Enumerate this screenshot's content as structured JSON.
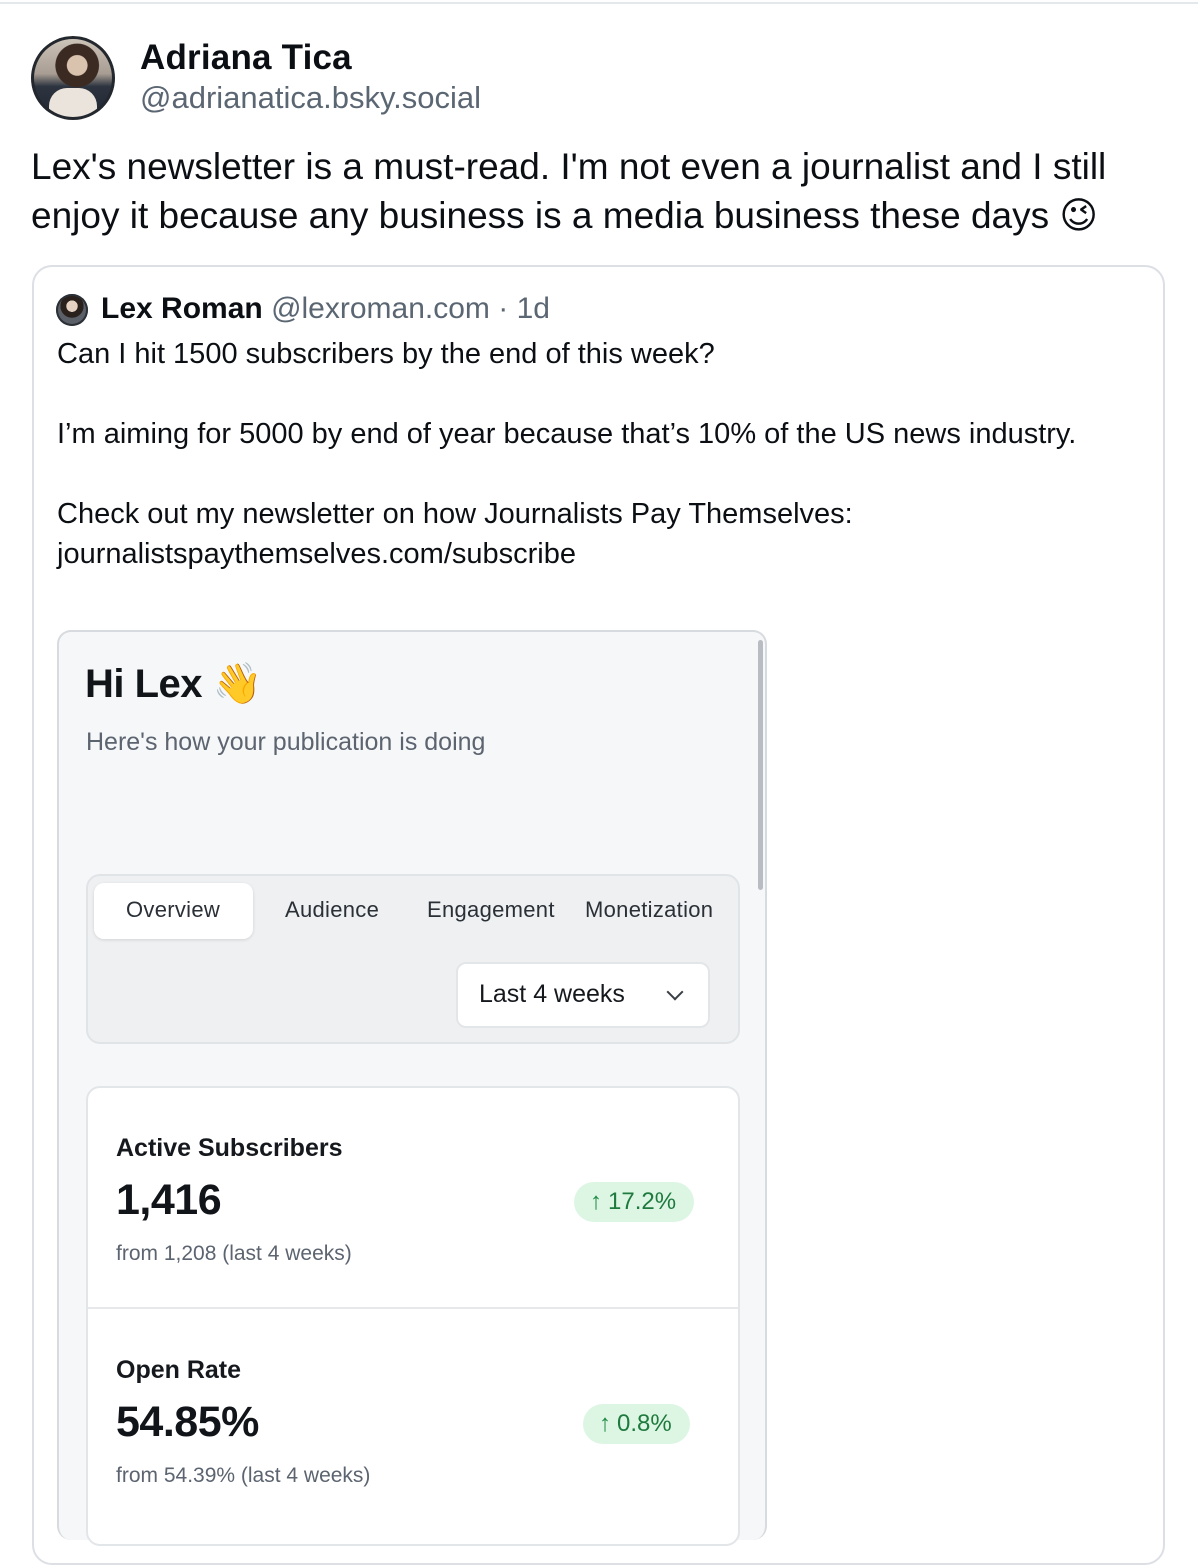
{
  "post": {
    "author_name": "Adriana Tica",
    "author_handle": "@adrianatica.bsky.social",
    "text": "Lex's newsletter is a must-read. I'm not even a journalist and I still enjoy it because any business is a media business these days 😉"
  },
  "quote": {
    "author_name": "Lex Roman",
    "author_handle": "@lexroman.com",
    "separator": " · ",
    "age": "1d",
    "text": "Can I hit 1500 subscribers by the end of this week?\n\nI’m aiming for 5000 by end of year because that’s 10% of the US news industry.\n\nCheck out my newsletter on how Journalists Pay Themselves:\njournalistspaythemselves.com/subscribe"
  },
  "dashboard": {
    "greeting": "Hi Lex",
    "greeting_emoji": "👋",
    "subtitle": "Here's how your publication is doing",
    "tabs": [
      {
        "label": "Overview",
        "active": true
      },
      {
        "label": "Audience",
        "active": false
      },
      {
        "label": "Engagement",
        "active": false
      },
      {
        "label": "Monetization",
        "active": false
      }
    ],
    "period_select": "Last 4 weeks",
    "stats": [
      {
        "title": "Active Subscribers",
        "value": "1,416",
        "change": "17.2%",
        "from": "from 1,208 (last 4 weeks)"
      },
      {
        "title": "Open Rate",
        "value": "54.85%",
        "change": "0.8%",
        "from": "from 54.39% (last 4 weeks)"
      }
    ]
  },
  "colors": {
    "badge_bg": "#dcf6e3",
    "badge_text": "#1f7a3e",
    "muted_text": "#5b6673"
  }
}
